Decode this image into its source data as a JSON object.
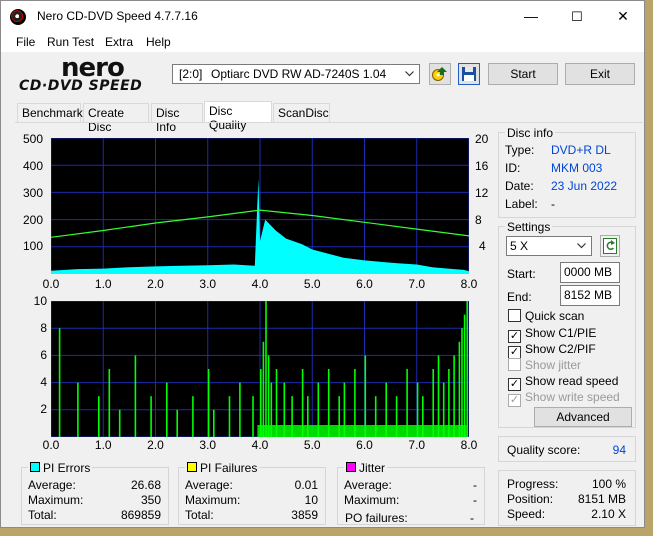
{
  "window": {
    "title": "Nero CD-DVD Speed 4.7.7.16",
    "minimize": "—",
    "maximize": "☐",
    "close": "✕"
  },
  "menu": [
    "File",
    "Run Test",
    "Extra",
    "Help"
  ],
  "logo": {
    "top": "nero",
    "bottom": "CD·DVD SPEED"
  },
  "toolbar": {
    "drive_id": "[2:0]",
    "drive_name": "Optiarc DVD RW AD-7240S 1.04",
    "start": "Start",
    "exit": "Exit",
    "dropdown_icon": "chevron-down-icon",
    "eject_icon": "eject-icon",
    "save_icon": "save-icon"
  },
  "tabs": [
    "Benchmark",
    "Create Disc",
    "Disc Info",
    "Disc Quality",
    "ScanDisc"
  ],
  "active_tab": "Disc Quality",
  "disc_info": {
    "title": "Disc info",
    "type_label": "Type:",
    "type": "DVD+R DL",
    "id_label": "ID:",
    "id": "MKM 003",
    "date_label": "Date:",
    "date": "23 Jun 2022",
    "label_label": "Label:",
    "label": "-"
  },
  "settings": {
    "title": "Settings",
    "speed": "5 X",
    "start_label": "Start:",
    "start": "0000 MB",
    "end_label": "End:",
    "end": "8152 MB",
    "quick_scan": {
      "label": "Quick scan",
      "checked": false,
      "enabled": true
    },
    "show_c1pie": {
      "label": "Show C1/PIE",
      "checked": true,
      "enabled": true
    },
    "show_c2pif": {
      "label": "Show C2/PIF",
      "checked": true,
      "enabled": true
    },
    "show_jitter": {
      "label": "Show jitter",
      "checked": false,
      "enabled": false
    },
    "show_read_speed": {
      "label": "Show read speed",
      "checked": true,
      "enabled": true
    },
    "show_write_speed": {
      "label": "Show write speed",
      "checked": true,
      "enabled": false
    },
    "advanced": "Advanced",
    "refresh_icon": "refresh-icon"
  },
  "quality": {
    "label": "Quality score:",
    "score": "94"
  },
  "progress": {
    "progress_label": "Progress:",
    "progress": "100 %",
    "position_label": "Position:",
    "position": "8151 MB",
    "speed_label": "Speed:",
    "speed": "2.10 X"
  },
  "pi_errors": {
    "title": "PI Errors",
    "color": "#00ffff",
    "average_label": "Average:",
    "average": "26.68",
    "maximum_label": "Maximum:",
    "maximum": "350",
    "total_label": "Total:",
    "total": "869859"
  },
  "pi_failures": {
    "title": "PI Failures",
    "color": "#ffff00",
    "average_label": "Average:",
    "average": "0.01",
    "maximum_label": "Maximum:",
    "maximum": "10",
    "total_label": "Total:",
    "total": "3859"
  },
  "jitter": {
    "title": "Jitter",
    "color": "#ff00ff",
    "average_label": "Average:",
    "average": "-",
    "maximum_label": "Maximum:",
    "maximum": "-",
    "po_failures_label": "PO failures:",
    "po_failures": "-"
  },
  "chart_data": [
    {
      "type": "area",
      "name": "PI Errors / read speed",
      "x_ticks": [
        "0.0",
        "1.0",
        "2.0",
        "3.0",
        "4.0",
        "5.0",
        "6.0",
        "7.0",
        "8.0"
      ],
      "y_ticks_left": [
        "500",
        "400",
        "300",
        "200",
        "100"
      ],
      "y_ticks_right": [
        "20",
        "16",
        "12",
        "8",
        "4"
      ],
      "xlim": [
        0,
        8
      ],
      "ylim": [
        0,
        500
      ],
      "y2lim": [
        0,
        20
      ],
      "series": [
        {
          "color": "#00ffff",
          "x": [
            0,
            0.5,
            1,
            1.5,
            2,
            2.5,
            3,
            3.5,
            3.9,
            3.97,
            4.0,
            4.1,
            4.3,
            4.5,
            4.8,
            5.0,
            5.3,
            5.6,
            6.0,
            6.3,
            6.6,
            7.0,
            7.3,
            7.6,
            7.9,
            8.0
          ],
          "values": [
            12,
            18,
            20,
            25,
            28,
            30,
            32,
            35,
            30,
            350,
            120,
            200,
            160,
            130,
            110,
            90,
            75,
            60,
            50,
            45,
            40,
            35,
            25,
            20,
            15,
            10
          ]
        },
        {
          "color": "#33ff33",
          "axis": "right",
          "x": [
            0,
            1,
            2,
            3,
            4,
            5,
            6,
            7,
            8
          ],
          "values": [
            5.4,
            6.4,
            7.5,
            8.4,
            9.4,
            8.6,
            7.6,
            6.6,
            5.6
          ]
        }
      ]
    },
    {
      "type": "bar",
      "name": "PI Failures",
      "x_ticks": [
        "0.0",
        "1.0",
        "2.0",
        "3.0",
        "4.0",
        "5.0",
        "6.0",
        "7.0",
        "8.0"
      ],
      "y_ticks": [
        "10",
        "8",
        "6",
        "4",
        "2"
      ],
      "xlim": [
        0,
        8
      ],
      "ylim": [
        0,
        10
      ],
      "series": [
        {
          "color": "#00ff00",
          "x": [
            0.15,
            0.5,
            0.9,
            1.1,
            1.3,
            1.6,
            1.9,
            2.2,
            2.4,
            2.7,
            3.0,
            3.1,
            3.4,
            3.6,
            3.85,
            4.0,
            4.05,
            4.1,
            4.15,
            4.2,
            4.3,
            4.45,
            4.6,
            4.8,
            4.9,
            5.1,
            5.3,
            5.5,
            5.6,
            5.8,
            6.0,
            6.2,
            6.4,
            6.6,
            6.8,
            7.0,
            7.1,
            7.3,
            7.4,
            7.5,
            7.6,
            7.7,
            7.8,
            7.85,
            7.9,
            7.95
          ],
          "values": [
            8,
            4,
            3,
            5,
            2,
            6,
            3,
            4,
            2,
            3,
            5,
            2,
            3,
            4,
            3,
            5,
            7,
            10,
            6,
            4,
            5,
            4,
            3,
            5,
            3,
            4,
            5,
            3,
            4,
            5,
            6,
            3,
            4,
            3,
            5,
            4,
            3,
            5,
            6,
            4,
            5,
            6,
            7,
            8,
            9,
            10
          ]
        }
      ]
    }
  ]
}
